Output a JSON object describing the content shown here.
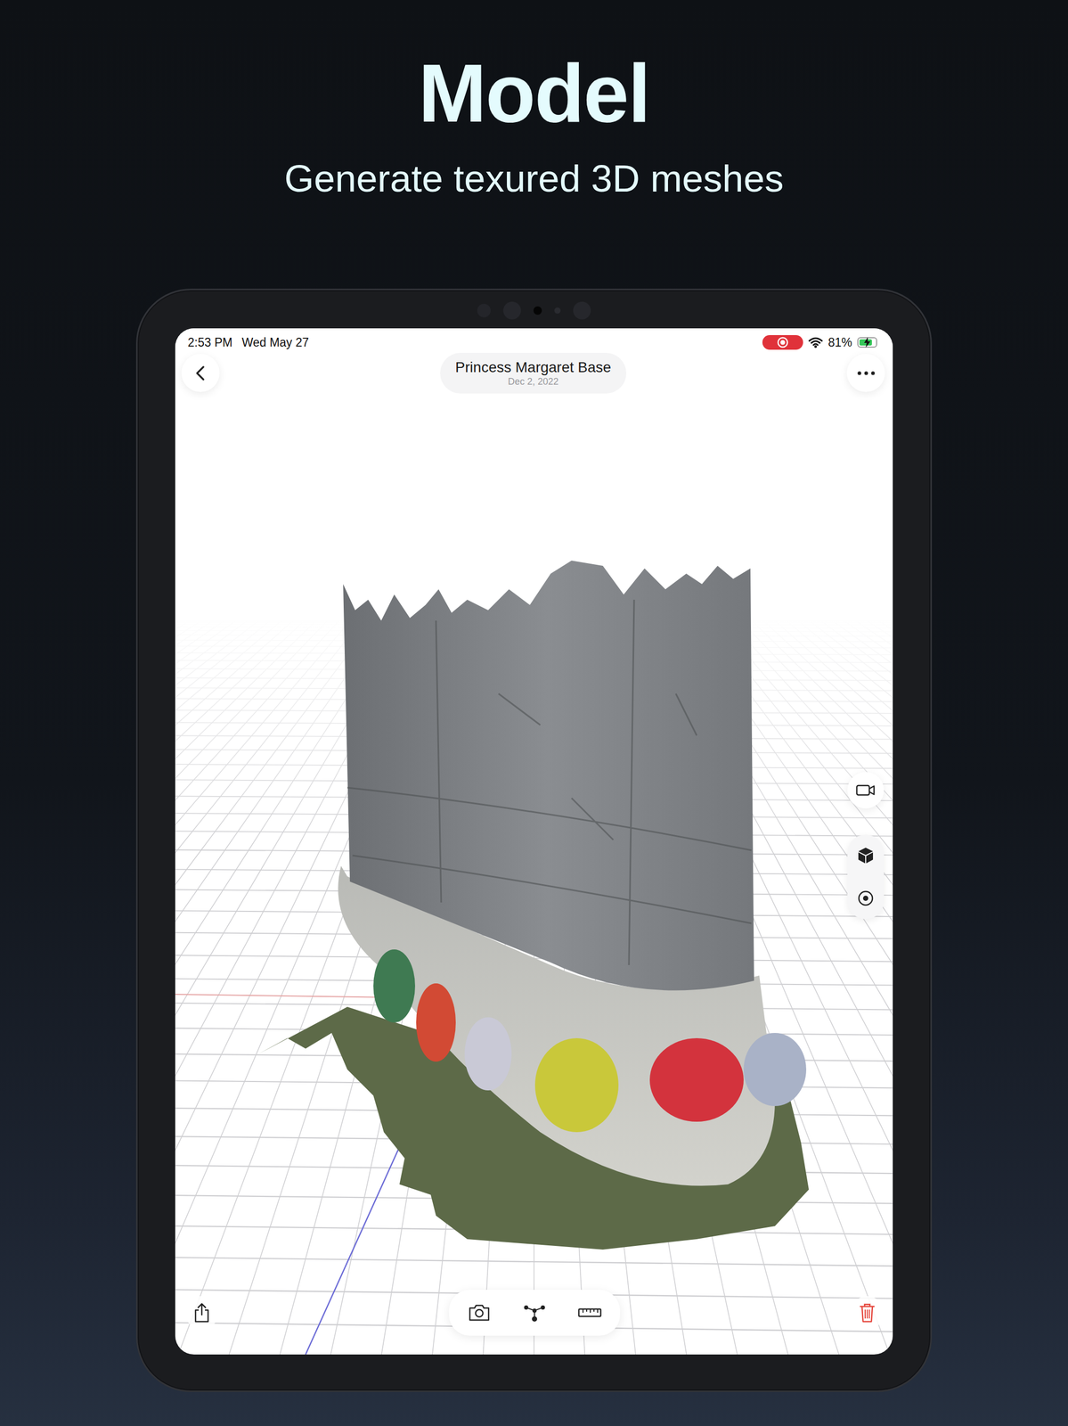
{
  "header": {
    "title": "Model",
    "subtitle": "Generate texured 3D meshes"
  },
  "status_bar": {
    "time": "2:53 PM",
    "date": "Wed May 27",
    "recording": true,
    "battery": "81%",
    "battery_level": 0.81,
    "charging": true
  },
  "nav": {
    "title": "Princess Margaret Base",
    "date": "Dec 2, 2022"
  }
}
